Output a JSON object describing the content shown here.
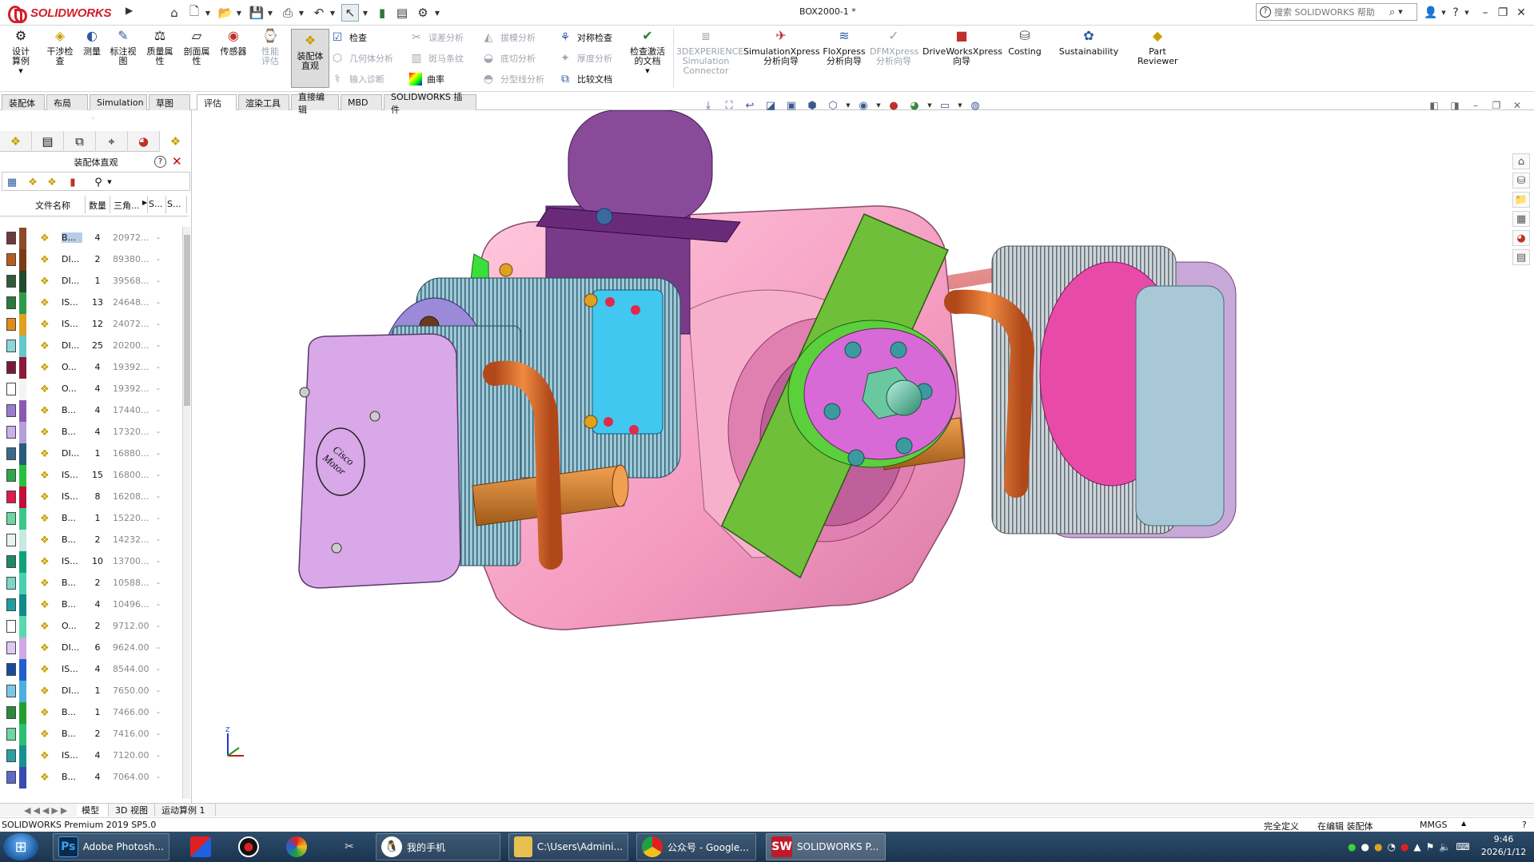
{
  "titlebar": {
    "logo_text": "SOLIDWORKS",
    "doc_title": "BOX2000-1 *",
    "help_search_placeholder": "搜索 SOLIDWORKS 帮助"
  },
  "ribbon": {
    "buttons": [
      {
        "label": "设计算例",
        "icon": "design-study-icon"
      },
      {
        "label": "干涉检查",
        "icon": "interference-icon"
      },
      {
        "label": "测量",
        "icon": "measure-icon"
      },
      {
        "label": "标注视图",
        "icon": "markup-icon"
      },
      {
        "label": "质量属性",
        "icon": "mass-props-icon"
      },
      {
        "label": "剖面属性",
        "icon": "section-props-icon"
      },
      {
        "label": "传感器",
        "icon": "sensor-icon"
      },
      {
        "label": "性能评估",
        "icon": "performance-icon"
      },
      {
        "label": "装配体直观",
        "icon": "assembly-visualization-icon"
      }
    ],
    "small_col1": [
      "检查",
      "几何体分析",
      "输入诊断"
    ],
    "small_col2": [
      "误差分析",
      "斑马条纹",
      "曲率"
    ],
    "small_col3": [
      "拔模分析",
      "底切分析",
      "分型线分析"
    ],
    "small_col4": [
      "对称检查",
      "厚度分析",
      "比较文档"
    ],
    "check_activate": "检查激活的文档",
    "big_right": [
      {
        "label": "3DEXPERIENCE Simulation Connector"
      },
      {
        "label": "SimulationXpress 分析向导"
      },
      {
        "label": "FloXpress 分析向导"
      },
      {
        "label": "DFMXpress 分析向导"
      },
      {
        "label": "DriveWorksXpress 向导"
      },
      {
        "label": "Costing"
      },
      {
        "label": "Sustainability"
      },
      {
        "label": "Part Reviewer"
      }
    ]
  },
  "command_tabs": [
    "装配体",
    "布局",
    "Simulation",
    "草图",
    "评估",
    "渲染工具",
    "直接编辑",
    "MBD",
    "SOLIDWORKS 插件"
  ],
  "panel": {
    "title": "装配体直观",
    "columns": [
      "文件名称",
      "数量",
      "三角...",
      "S...",
      "S..."
    ],
    "rows": [
      {
        "name": "B...",
        "qty": "4",
        "tri": "20972...",
        "dash": "-",
        "c1": "#6b3a3a",
        "c2": "#8b4a2a"
      },
      {
        "name": "DI...",
        "qty": "2",
        "tri": "89380...",
        "dash": "-",
        "c1": "#b65b1f",
        "c2": "#7a3b16"
      },
      {
        "name": "DI...",
        "qty": "1",
        "tri": "39568...",
        "dash": "-",
        "c1": "#2f5d3a",
        "c2": "#1f4a2e"
      },
      {
        "name": "IS...",
        "qty": "13",
        "tri": "24648...",
        "dash": "-",
        "c1": "#2a7a3a",
        "c2": "#2f9a4a"
      },
      {
        "name": "IS...",
        "qty": "12",
        "tri": "24072...",
        "dash": "-",
        "c1": "#e48a1a",
        "c2": "#e0a020"
      },
      {
        "name": "DI...",
        "qty": "25",
        "tri": "20200...",
        "dash": "-",
        "c1": "#8ad8d8",
        "c2": "#63c8c8"
      },
      {
        "name": "O...",
        "qty": "4",
        "tri": "19392...",
        "dash": "-",
        "c1": "#7a1a3a",
        "c2": "#8b1a3a"
      },
      {
        "name": "O...",
        "qty": "4",
        "tri": "19392...",
        "dash": "-",
        "c1": "#ffffff",
        "c2": "#f4f4f4"
      },
      {
        "name": "B...",
        "qty": "4",
        "tri": "17440...",
        "dash": "-",
        "c1": "#9b7bd0",
        "c2": "#8a5ab0"
      },
      {
        "name": "B...",
        "qty": "4",
        "tri": "17320...",
        "dash": "-",
        "c1": "#c8b0e8",
        "c2": "#b6a0d8"
      },
      {
        "name": "DI...",
        "qty": "1",
        "tri": "16880...",
        "dash": "-",
        "c1": "#3a6a8a",
        "c2": "#2a5a7a"
      },
      {
        "name": "IS...",
        "qty": "15",
        "tri": "16800...",
        "dash": "-",
        "c1": "#2fa84a",
        "c2": "#27c040"
      },
      {
        "name": "IS...",
        "qty": "8",
        "tri": "16208...",
        "dash": "-",
        "c1": "#e01a4a",
        "c2": "#c0103a"
      },
      {
        "name": "B...",
        "qty": "1",
        "tri": "15220...",
        "dash": "-",
        "c1": "#6ad8a0",
        "c2": "#3ac88a"
      },
      {
        "name": "B...",
        "qty": "2",
        "tri": "14232...",
        "dash": "-",
        "c1": "#e8f4f0",
        "c2": "#c8e8e0"
      },
      {
        "name": "IS...",
        "qty": "10",
        "tri": "13700...",
        "dash": "-",
        "c1": "#1a8a6a",
        "c2": "#12a07a"
      },
      {
        "name": "B...",
        "qty": "2",
        "tri": "10588...",
        "dash": "-",
        "c1": "#7ad8c8",
        "c2": "#4ad0b0"
      },
      {
        "name": "B...",
        "qty": "4",
        "tri": "10496...",
        "dash": "-",
        "c1": "#1aa0a0",
        "c2": "#108a8a"
      },
      {
        "name": "O...",
        "qty": "2",
        "tri": "9712.00",
        "dash": "-",
        "c1": "#ffffff",
        "c2": "#5ad8b0"
      },
      {
        "name": "DI...",
        "qty": "6",
        "tri": "9624.00",
        "dash": "-",
        "c1": "#e0c8f0",
        "c2": "#d0a8e8"
      },
      {
        "name": "IS...",
        "qty": "4",
        "tri": "8544.00",
        "dash": "-",
        "c1": "#1a4aa0",
        "c2": "#2060c8"
      },
      {
        "name": "DI...",
        "qty": "1",
        "tri": "7650.00",
        "dash": "-",
        "c1": "#7ac8e8",
        "c2": "#4ab0e0"
      },
      {
        "name": "B...",
        "qty": "1",
        "tri": "7466.00",
        "dash": "-",
        "c1": "#2a8a3a",
        "c2": "#20a030"
      },
      {
        "name": "B...",
        "qty": "2",
        "tri": "7416.00",
        "dash": "-",
        "c1": "#6ad8a0",
        "c2": "#2ac070"
      },
      {
        "name": "IS...",
        "qty": "4",
        "tri": "7120.00",
        "dash": "-",
        "c1": "#2aa0a0",
        "c2": "#1a9090"
      },
      {
        "name": "B...",
        "qty": "4",
        "tri": "7064.00",
        "dash": "-",
        "c1": "#5a6ac8",
        "c2": "#3a4ab0"
      }
    ]
  },
  "bottom_tabs": [
    "模型",
    "3D 视图",
    "运动算例 1"
  ],
  "status": {
    "left": "SOLIDWORKS Premium 2019 SP5.0",
    "define": "完全定义",
    "editing": "在编辑 装配体",
    "units": "MMGS"
  },
  "taskbar": {
    "items": [
      "Adobe Photosh...",
      "我的手机",
      "C:\\Users\\Admini...",
      "公众号 - Google...",
      "SOLIDWORKS P..."
    ],
    "time": "9:46",
    "date": "2026/1/12"
  },
  "model": {
    "motor_label_1": "Cisco",
    "motor_label_2": "Motor"
  },
  "colors": {
    "accent": "#d21e2b",
    "body": "#f7a8c8",
    "propeller": "#6fbf3a",
    "handle": "#c86a6a",
    "mount": "#7a3a8a",
    "pipes": "#e06a1a"
  }
}
